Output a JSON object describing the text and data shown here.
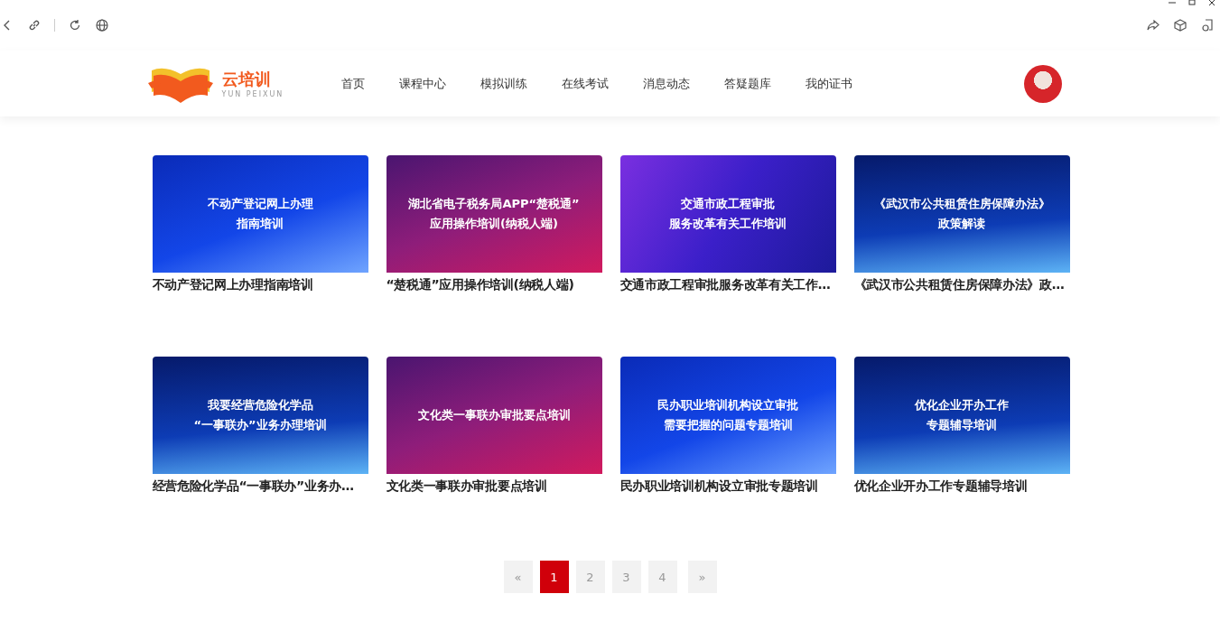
{
  "logo": {
    "name": "云培训",
    "subtitle": "YUN PEIXUN"
  },
  "nav": [
    {
      "label": "首页",
      "selected": false
    },
    {
      "label": "课程中心",
      "selected": false
    },
    {
      "label": "模拟训练",
      "selected": false
    },
    {
      "label": "在线考试",
      "selected": false
    },
    {
      "label": "消息动态",
      "selected": false
    },
    {
      "label": "答疑题库",
      "selected": false
    },
    {
      "label": "我的证书",
      "selected": false
    }
  ],
  "courses": [
    {
      "kind": "blue",
      "cover_lines": [
        "不动产登记网上办理",
        "指南培训"
      ],
      "title": "不动产登记网上办理指南培训"
    },
    {
      "kind": "magenta",
      "cover_lines": [
        "湖北省电子税务局APP“楚税通”",
        "应用操作培训(纳税人端)"
      ],
      "title": "“楚税通”应用操作培训(纳税人端)"
    },
    {
      "kind": "violet",
      "cover_lines": [
        "交通市政工程审批",
        "服务改革有关工作培训"
      ],
      "title": "交通市政工程审批服务改革有关工作…"
    },
    {
      "kind": "navy",
      "cover_lines": [
        "《武汉市公共租赁住房保障办法》",
        "政策解读"
      ],
      "title": "《武汉市公共租赁住房保障办法》政…"
    },
    {
      "kind": "navy",
      "cover_lines": [
        "我要经营危险化学品",
        "“一事联办”业务办理培训"
      ],
      "title": "经营危险化学品“一事联办”业务办…"
    },
    {
      "kind": "magenta",
      "cover_lines": [
        "文化类一事联办审批要点培训"
      ],
      "title": "文化类一事联办审批要点培训"
    },
    {
      "kind": "blue",
      "cover_lines": [
        "民办职业培训机构设立审批",
        "需要把握的问题专题培训"
      ],
      "title": "民办职业培训机构设立审批专题培训"
    },
    {
      "kind": "navy",
      "cover_lines": [
        "优化企业开办工作",
        "专题辅导培训"
      ],
      "title": "优化企业开办工作专题辅导培训"
    }
  ],
  "pagination": {
    "prev": "«",
    "next": "»",
    "pages": [
      {
        "label": "1",
        "selected": true
      },
      {
        "label": "2",
        "selected": false
      },
      {
        "label": "3",
        "selected": false
      },
      {
        "label": "4",
        "selected": false
      }
    ]
  }
}
